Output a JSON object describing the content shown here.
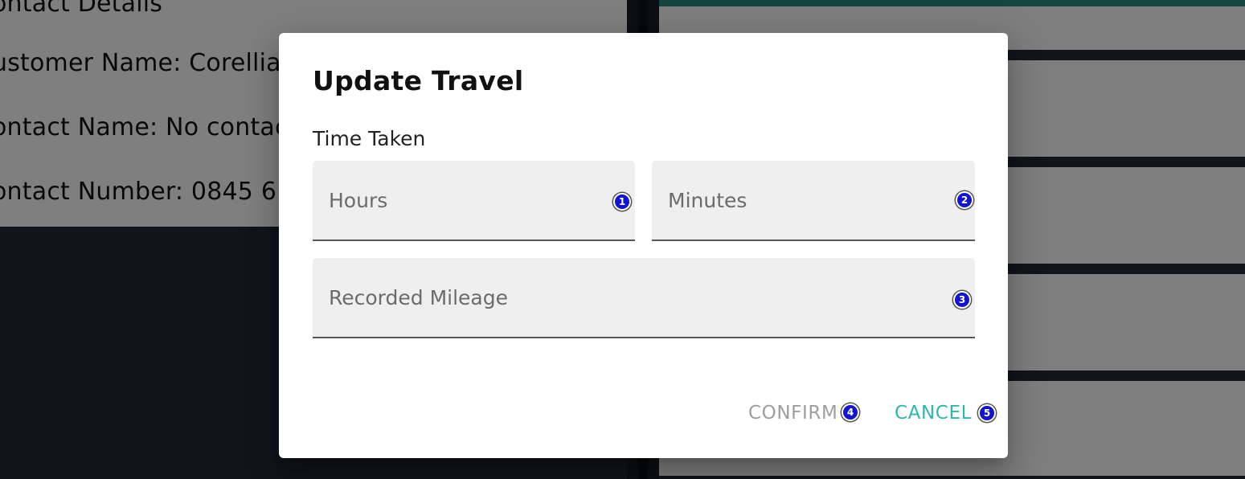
{
  "background": {
    "contact_details": {
      "heading": "ontact Details",
      "customer_name": "ustomer Name: Corellia",
      "contact_name": "ontact Name: No contac",
      "contact_number": "ontact Number: 0845 6"
    }
  },
  "dialog": {
    "title": "Update Travel",
    "time_label": "Time Taken",
    "hours": {
      "value": "",
      "placeholder": "Hours"
    },
    "minutes": {
      "value": "",
      "placeholder": "Minutes"
    },
    "mileage": {
      "value": "",
      "placeholder": "Recorded Mileage"
    },
    "confirm_label": "CONFIRM",
    "cancel_label": "CANCEL"
  },
  "badges": [
    "1",
    "2",
    "3",
    "4",
    "5"
  ],
  "colors": {
    "accent": "#34b5aa",
    "disabled": "#9e9e9e",
    "badge": "#1414c8",
    "app_dark": "#232936"
  }
}
